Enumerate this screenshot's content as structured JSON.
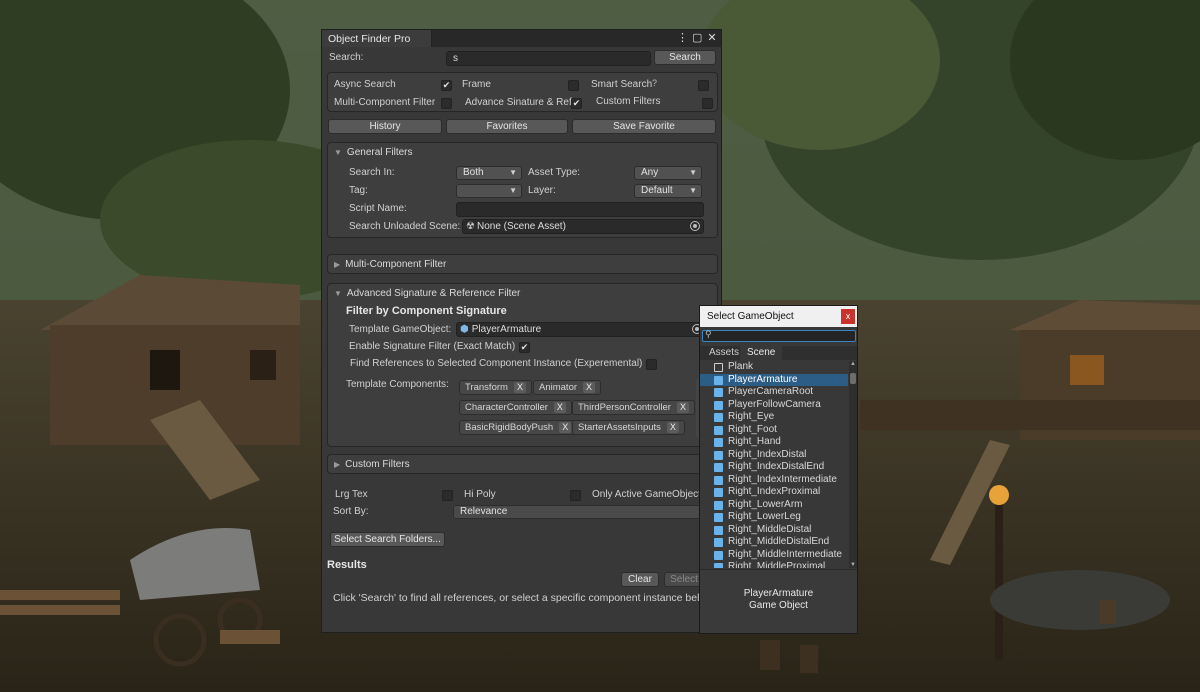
{
  "colors": {
    "panel_bg": "#383838",
    "accent_selection": "#2c5d87",
    "close_red": "#c8342c",
    "gameobject_blue": "#6ab2ea"
  },
  "window": {
    "title": "Object Finder Pro",
    "menu_icon": "kebab-icon",
    "maximize_icon": "maximize-icon",
    "close_icon": "close-icon"
  },
  "search": {
    "label": "Search:",
    "value": "s",
    "button": "Search"
  },
  "options": {
    "async_search": {
      "label": "Async Search",
      "checked": true
    },
    "frame": {
      "label": "Frame",
      "checked": false
    },
    "smart_search": {
      "label": "Smart Search",
      "checked": false
    },
    "multi_component": {
      "label": "Multi-Component Filter",
      "checked": false
    },
    "advance_signature": {
      "label": "Advance Sinature & Ref",
      "checked": true
    },
    "custom_filters": {
      "label": "Custom Filters",
      "checked": false
    }
  },
  "toolbar": {
    "history": "History",
    "favorites": "Favorites",
    "save_favorite": "Save Favorite"
  },
  "general_filters": {
    "title": "General Filters",
    "search_in_label": "Search In:",
    "search_in_value": "Both",
    "asset_type_label": "Asset Type:",
    "asset_type_value": "Any",
    "tag_label": "Tag:",
    "tag_value": "",
    "layer_label": "Layer:",
    "layer_value": "Default",
    "script_name_label": "Script Name:",
    "script_name_value": "",
    "unloaded_scene_label": "Search Unloaded Scene:",
    "unloaded_scene_value": "None (Scene Asset)"
  },
  "multi_component_filter": {
    "title": "Multi-Component Filter"
  },
  "advanced": {
    "title": "Advanced Signature & Reference Filter",
    "subtitle": "Filter by Component Signature",
    "template_go_label": "Template GameObject:",
    "template_go_value": "PlayerArmature",
    "enable_signature_label": "Enable Signature Filter (Exact Match)",
    "enable_signature_checked": true,
    "find_refs_label": "Find References to Selected Component Instance (Experemental)",
    "find_refs_checked": false,
    "template_components_label": "Template Components:",
    "components": [
      "Transform",
      "Animator",
      "CharacterController",
      "ThirdPersonController",
      "BasicRigidBodyPush",
      "StarterAssetsInputs"
    ],
    "remove_label": "X"
  },
  "custom_filters": {
    "title": "Custom Filters"
  },
  "misc": {
    "lrg_tex": "Lrg Tex",
    "hi_poly": "Hi Poly",
    "only_active": "Only Active GameObject",
    "sort_by_label": "Sort By:",
    "sort_by_value": "Relevance",
    "select_folders": "Select Search Folders..."
  },
  "results": {
    "title": "Results",
    "clear": "Clear",
    "select": "Select",
    "message": "Click 'Search' to find all references, or select a specific component instance below"
  },
  "popup": {
    "title": "Select GameObject",
    "close": "x",
    "search_value": "",
    "tabs": [
      "Assets",
      "Scene"
    ],
    "active_tab": "Scene",
    "items": [
      {
        "label": "Plank",
        "hollow": true
      },
      {
        "label": "PlayerArmature",
        "selected": true
      },
      {
        "label": "PlayerCameraRoot"
      },
      {
        "label": "PlayerFollowCamera"
      },
      {
        "label": "Right_Eye"
      },
      {
        "label": "Right_Foot"
      },
      {
        "label": "Right_Hand"
      },
      {
        "label": "Right_IndexDistal"
      },
      {
        "label": "Right_IndexDistalEnd"
      },
      {
        "label": "Right_IndexIntermediate"
      },
      {
        "label": "Right_IndexProximal"
      },
      {
        "label": "Right_LowerArm"
      },
      {
        "label": "Right_LowerLeg"
      },
      {
        "label": "Right_MiddleDistal"
      },
      {
        "label": "Right_MiddleDistalEnd"
      },
      {
        "label": "Right_MiddleIntermediate"
      },
      {
        "label": "Right_MiddleProximal"
      }
    ],
    "preview_name": "PlayerArmature",
    "preview_type": "Game Object"
  }
}
